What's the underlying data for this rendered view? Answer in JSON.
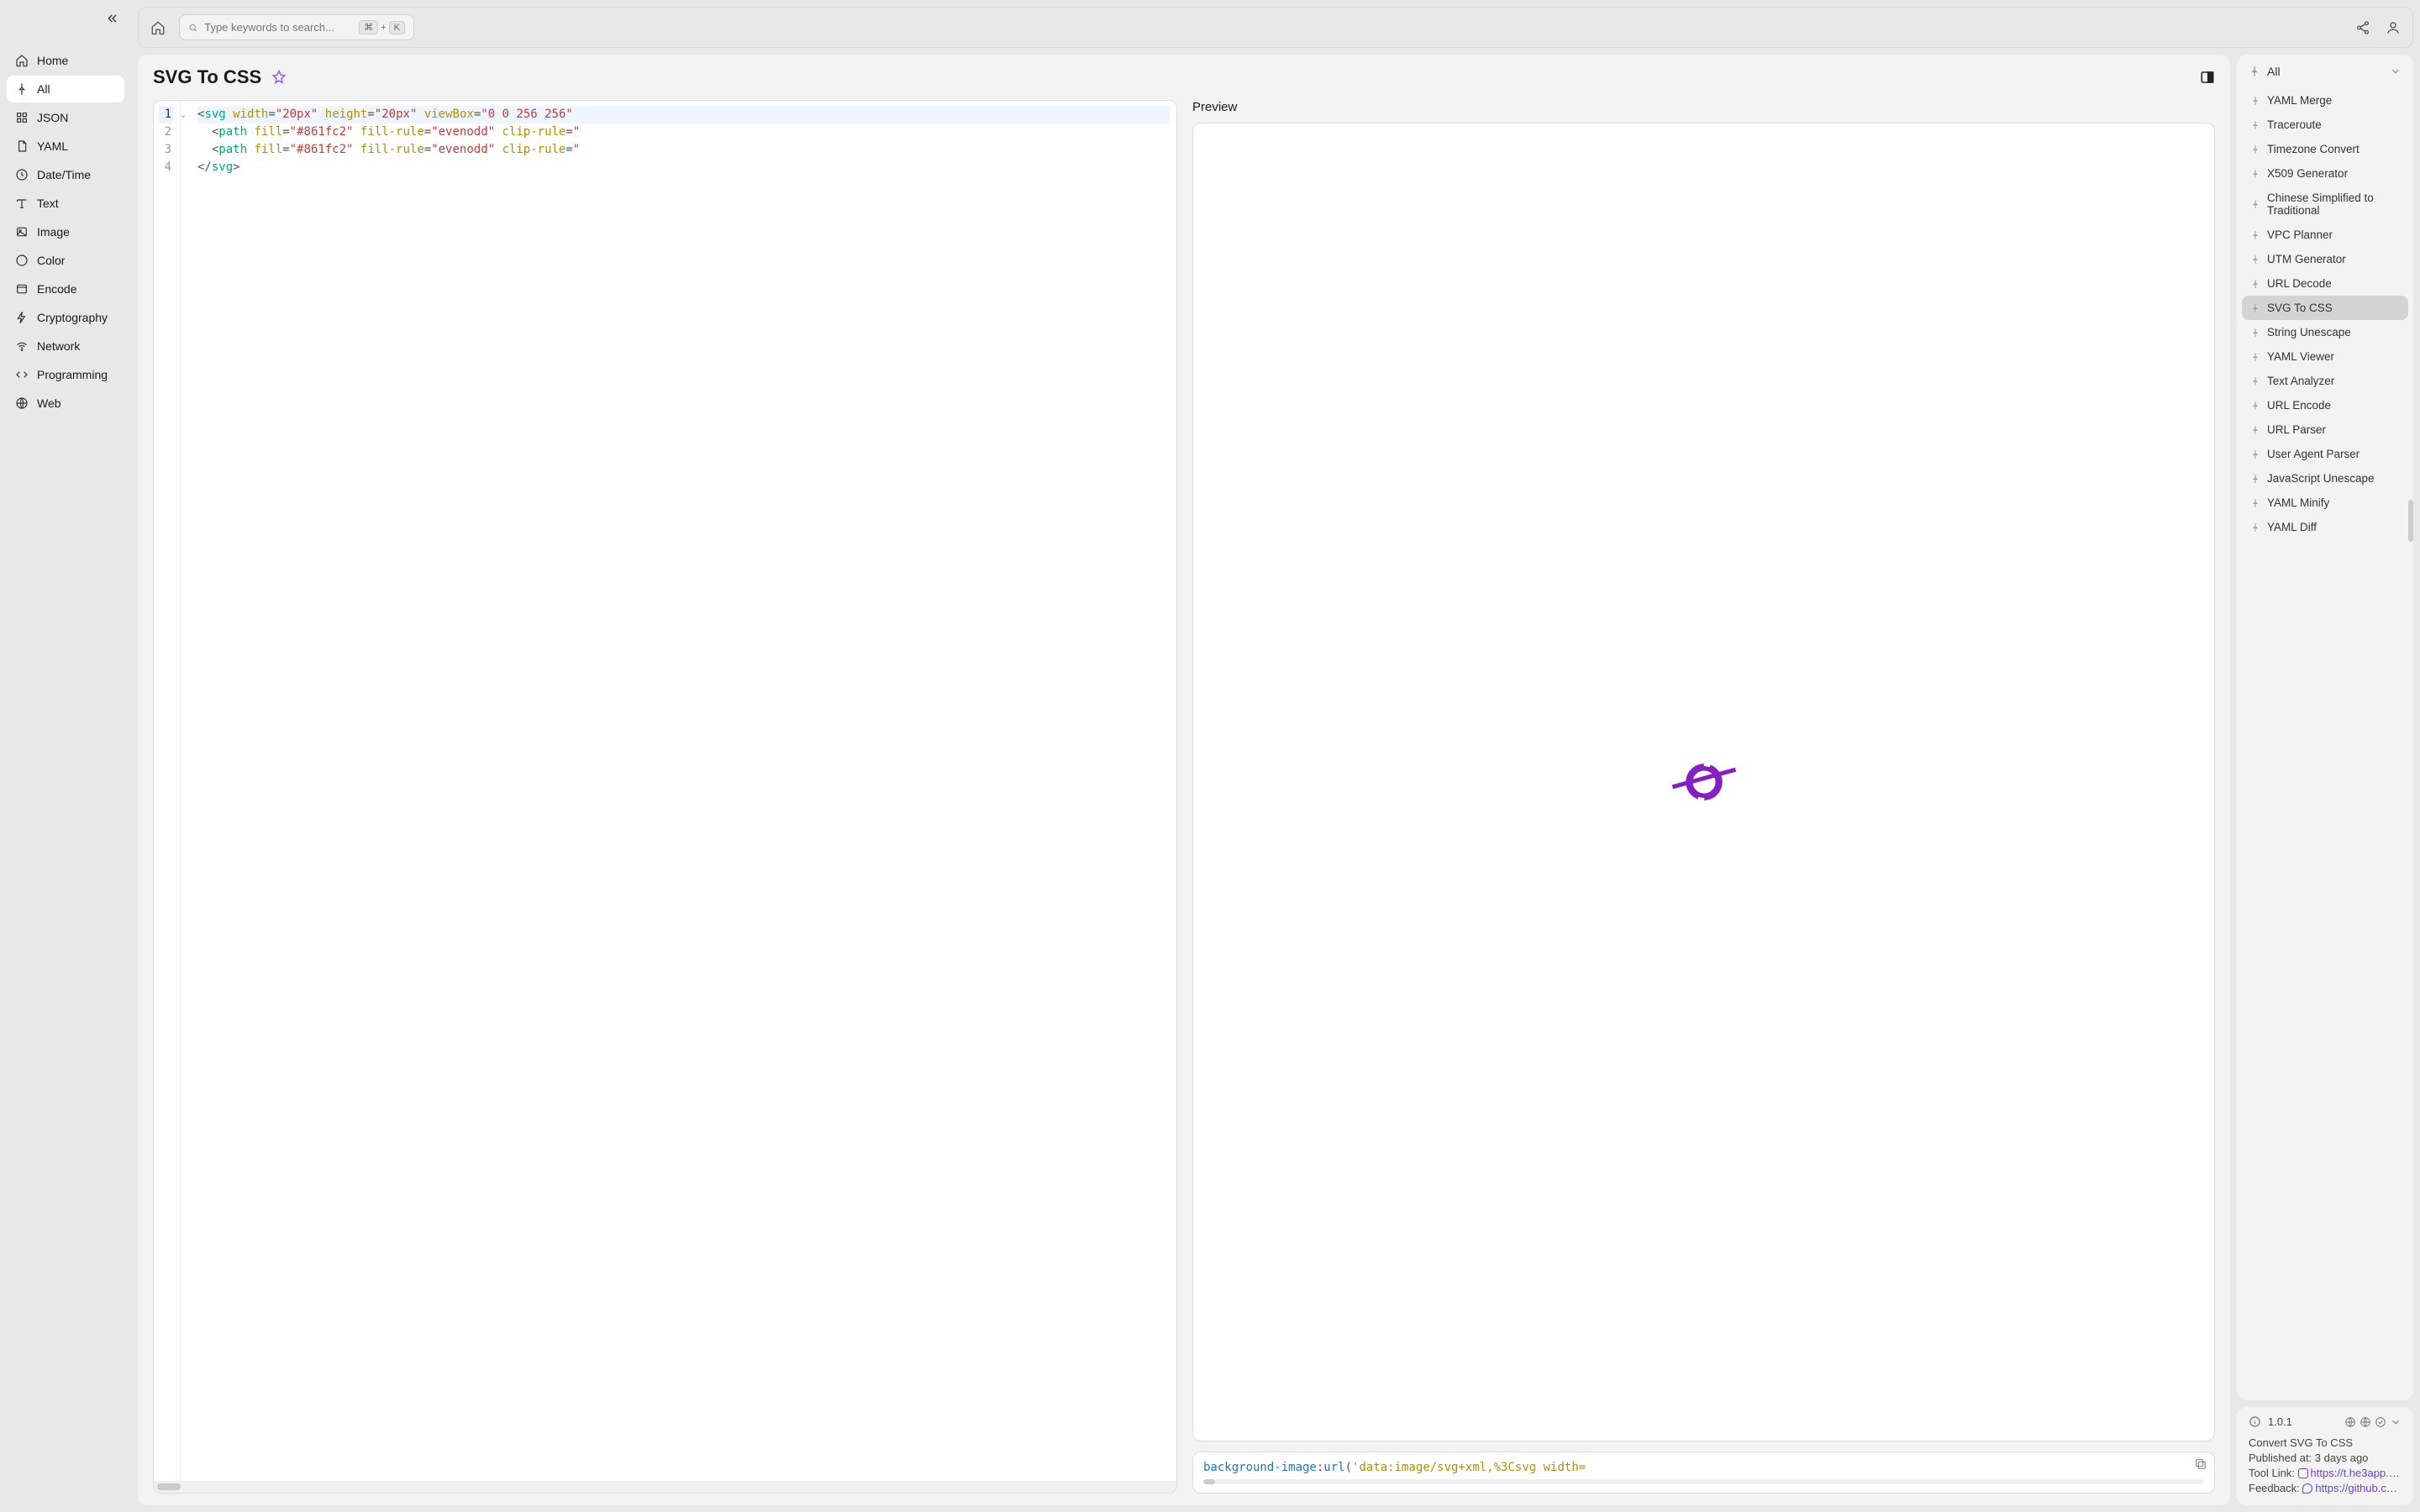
{
  "sidebar": {
    "items": [
      {
        "label": "Home",
        "icon": "home"
      },
      {
        "label": "All",
        "icon": "pin",
        "active": true
      },
      {
        "label": "JSON",
        "icon": "grid"
      },
      {
        "label": "YAML",
        "icon": "doc"
      },
      {
        "label": "Date/Time",
        "icon": "clock"
      },
      {
        "label": "Text",
        "icon": "text"
      },
      {
        "label": "Image",
        "icon": "image"
      },
      {
        "label": "Color",
        "icon": "color"
      },
      {
        "label": "Encode",
        "icon": "encode"
      },
      {
        "label": "Cryptography",
        "icon": "bolt"
      },
      {
        "label": "Network",
        "icon": "wifi"
      },
      {
        "label": "Programming",
        "icon": "code"
      },
      {
        "label": "Web",
        "icon": "globe"
      }
    ]
  },
  "search": {
    "placeholder": "Type keywords to search...",
    "kbd1": "⌘",
    "plus": "+",
    "kbd2": "K"
  },
  "page": {
    "title": "SVG To CSS"
  },
  "editor": {
    "line1": {
      "tag": "svg",
      "attrs": [
        [
          "width",
          "\"20px\""
        ],
        [
          "height",
          "\"20px\""
        ],
        [
          "viewBox",
          "\"0 0 256 256\""
        ]
      ],
      "tail": " "
    },
    "line2": {
      "tag": "path",
      "attrs": [
        [
          "fill",
          "\"#861fc2\""
        ],
        [
          "fill-rule",
          "\"evenodd\""
        ],
        [
          "clip-rule",
          "\""
        ]
      ],
      "indent": "  "
    },
    "line3": {
      "tag": "path",
      "attrs": [
        [
          "fill",
          "\"#861fc2\""
        ],
        [
          "fill-rule",
          "\"evenodd\""
        ],
        [
          "clip-rule",
          "\""
        ]
      ],
      "indent": "  "
    },
    "line4": {
      "close": "svg"
    }
  },
  "preview": {
    "label": "Preview",
    "logo_color": "#861fc2"
  },
  "output": {
    "prop": "background-image",
    "func": "url",
    "str_head": "'data:image/svg+xml,%3Csvg width="
  },
  "rightPanel": {
    "header": "All",
    "items": [
      "YAML Merge",
      "Traceroute",
      "Timezone Convert",
      "X509 Generator",
      "Chinese Simplified to Traditional",
      "VPC Planner",
      "UTM Generator",
      "URL Decode",
      "SVG To CSS",
      "String Unescape",
      "YAML Viewer",
      "Text Analyzer",
      "URL Encode",
      "URL Parser",
      "User Agent Parser",
      "JavaScript Unescape",
      "YAML Minify",
      "YAML Diff"
    ],
    "activeIndex": 8
  },
  "info": {
    "version": "1.0.1",
    "desc": "Convert SVG To CSS",
    "published_label": "Published at:",
    "published_value": "3 days ago",
    "toollink_label": "Tool Link:",
    "toollink_value": "https://t.he3app.co…",
    "feedback_label": "Feedback:",
    "feedback_value": "https://github.com/…"
  }
}
